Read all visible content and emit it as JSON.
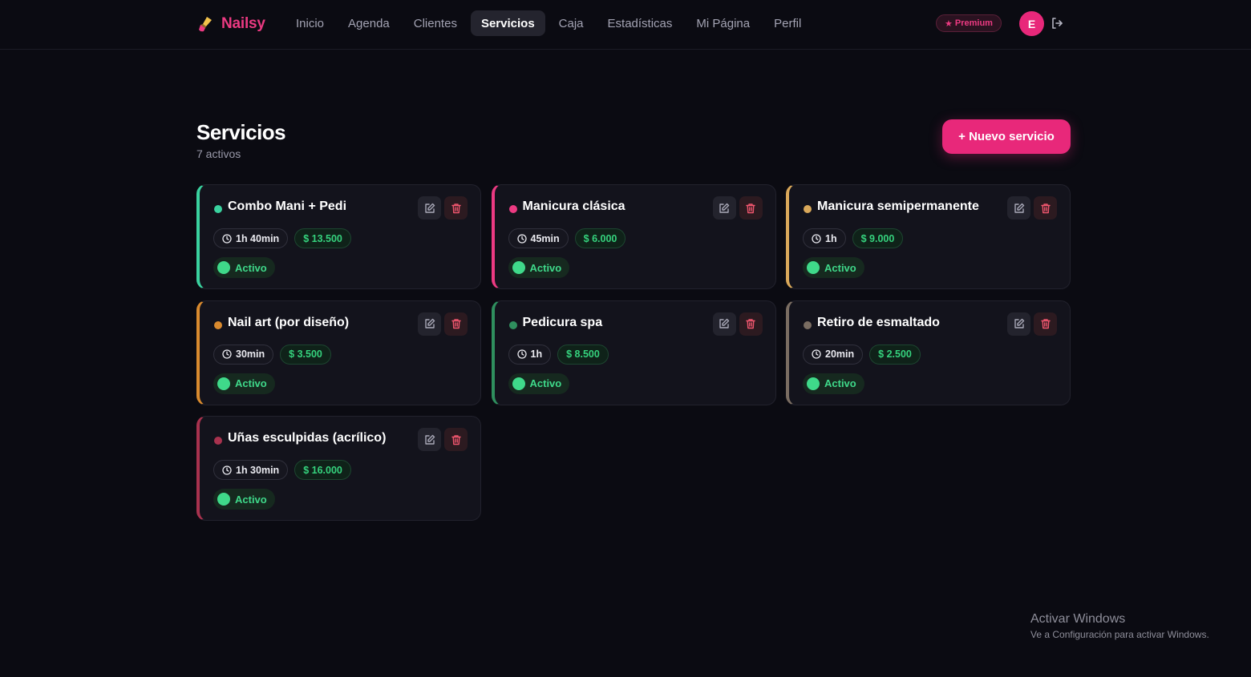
{
  "app": {
    "name": "Nailsy",
    "icon": "nail-polish-icon",
    "accent": "#ec3a82"
  },
  "nav": {
    "items": [
      "Inicio",
      "Agenda",
      "Clientes",
      "Servicios",
      "Caja",
      "Estadísticas",
      "Mi Página",
      "Perfil"
    ],
    "active": "Servicios"
  },
  "user": {
    "premium_label": "Premium",
    "premium_icon": "star-icon",
    "avatar_initial": "E",
    "logout_icon": "logout-icon"
  },
  "page": {
    "title": "Servicios",
    "subtitle": "7 activos",
    "new_button": "+ Nuevo servicio"
  },
  "services": [
    {
      "name": "Combo Mani + Pedi",
      "duration": "1h 40min",
      "price": "$ 13.500",
      "status": "Activo",
      "color": "#3ad29f"
    },
    {
      "name": "Manicura clásica",
      "duration": "45min",
      "price": "$ 6.000",
      "status": "Activo",
      "color": "#ec3a82"
    },
    {
      "name": "Manicura semipermanente",
      "duration": "1h",
      "price": "$ 9.000",
      "status": "Activo",
      "color": "#d9a85a"
    },
    {
      "name": "Nail art (por diseño)",
      "duration": "30min",
      "price": "$ 3.500",
      "status": "Activo",
      "color": "#d98a2e"
    },
    {
      "name": "Pedicura spa",
      "duration": "1h",
      "price": "$ 8.500",
      "status": "Activo",
      "color": "#2f8f5e"
    },
    {
      "name": "Retiro de esmaltado",
      "duration": "20min",
      "price": "$ 2.500",
      "status": "Activo",
      "color": "#7a6d62"
    },
    {
      "name": "Uñas esculpidas (acrílico)",
      "duration": "1h 30min",
      "price": "$ 16.000",
      "status": "Activo",
      "color": "#a8324e"
    }
  ],
  "card_icons": {
    "edit": "edit-icon",
    "delete": "trash-icon",
    "duration": "clock-icon"
  },
  "watermark": {
    "title": "Activar Windows",
    "subtitle": "Ve a Configuración para activar Windows."
  }
}
